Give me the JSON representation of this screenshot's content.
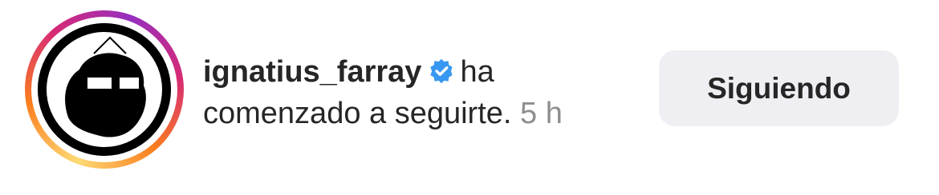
{
  "notification": {
    "username": "ignatius_farray",
    "verified_icon": "verified-badge-icon",
    "message_part1": "ha",
    "message_part2": "comenzado a seguirte.",
    "time": "5 h",
    "follow_button_label": "Siguiendo"
  },
  "colors": {
    "text": "#262626",
    "secondary_text": "#8e8e8e",
    "verified_blue": "#3897f0",
    "button_bg": "#efeff3",
    "story_ring": [
      "#feda75",
      "#fa7e1e",
      "#d62976",
      "#962fbf"
    ]
  }
}
